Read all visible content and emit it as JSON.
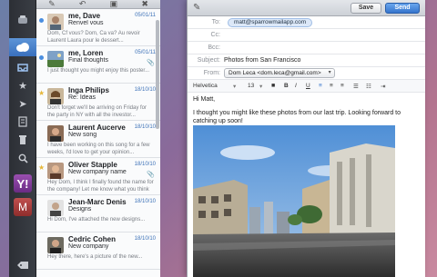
{
  "list": {
    "messages": [
      {
        "sender": "me, Dave",
        "date": "05/01/11",
        "subject": "Renvel vous",
        "preview": "Dom, Cf vous? Dom, Ca va? Au revoir Laurent Laura pour le dessert...",
        "unread": true,
        "starred": false
      },
      {
        "sender": "me, Loren",
        "date": "05/01/11",
        "subject": "Final thoughts",
        "preview": "I just thought you might enjoy this poster...",
        "unread": true,
        "starred": false
      },
      {
        "sender": "Inga Philips",
        "date": "18/10/10",
        "subject": "Re: Ideas",
        "preview": "Don't forget we'll be arriving on Friday for the party in NY with all the investor...",
        "unread": false,
        "starred": true
      },
      {
        "sender": "Laurent Aucerve",
        "date": "18/10/10",
        "subject": "New song",
        "preview": "I have been working on this song for a few weeks, I'd love to get your opinion...",
        "unread": false,
        "starred": false
      },
      {
        "sender": "Oliver Stapple",
        "date": "18/10/10",
        "subject": "New company name",
        "preview": "Hey Dom, I think I finally found the name for the company! Let me know what you think",
        "unread": false,
        "starred": true
      },
      {
        "sender": "Jean-Marc Denis",
        "date": "18/10/10",
        "subject": "Designs",
        "preview": "Hi Dom, I've attached the new designs...",
        "unread": false,
        "starred": false
      },
      {
        "sender": "Cedric Cohen",
        "date": "18/10/10",
        "subject": "New company",
        "preview": "Hey there, here's a picture of the new...",
        "unread": false,
        "starred": false
      }
    ]
  },
  "compose": {
    "save_label": "Save",
    "send_label": "Send",
    "to_label": "To:",
    "to_value": "matt@sparrowmailapp.com",
    "cc_label": "Cc:",
    "bcc_label": "Bcc:",
    "subject_label": "Subject:",
    "subject_value": "Photos from San Francisco",
    "from_label": "From:",
    "from_value": "Dom Leca <dom.leca@gmail.com>",
    "font_name": "Helvetica",
    "font_size": "13",
    "greeting": "Hi Matt,",
    "body_text": "I thought you might like these photos from our last trip. Looking forward to catching up soon!"
  },
  "colors": {
    "accent": "#3574cc",
    "date": "#3d72b8"
  }
}
